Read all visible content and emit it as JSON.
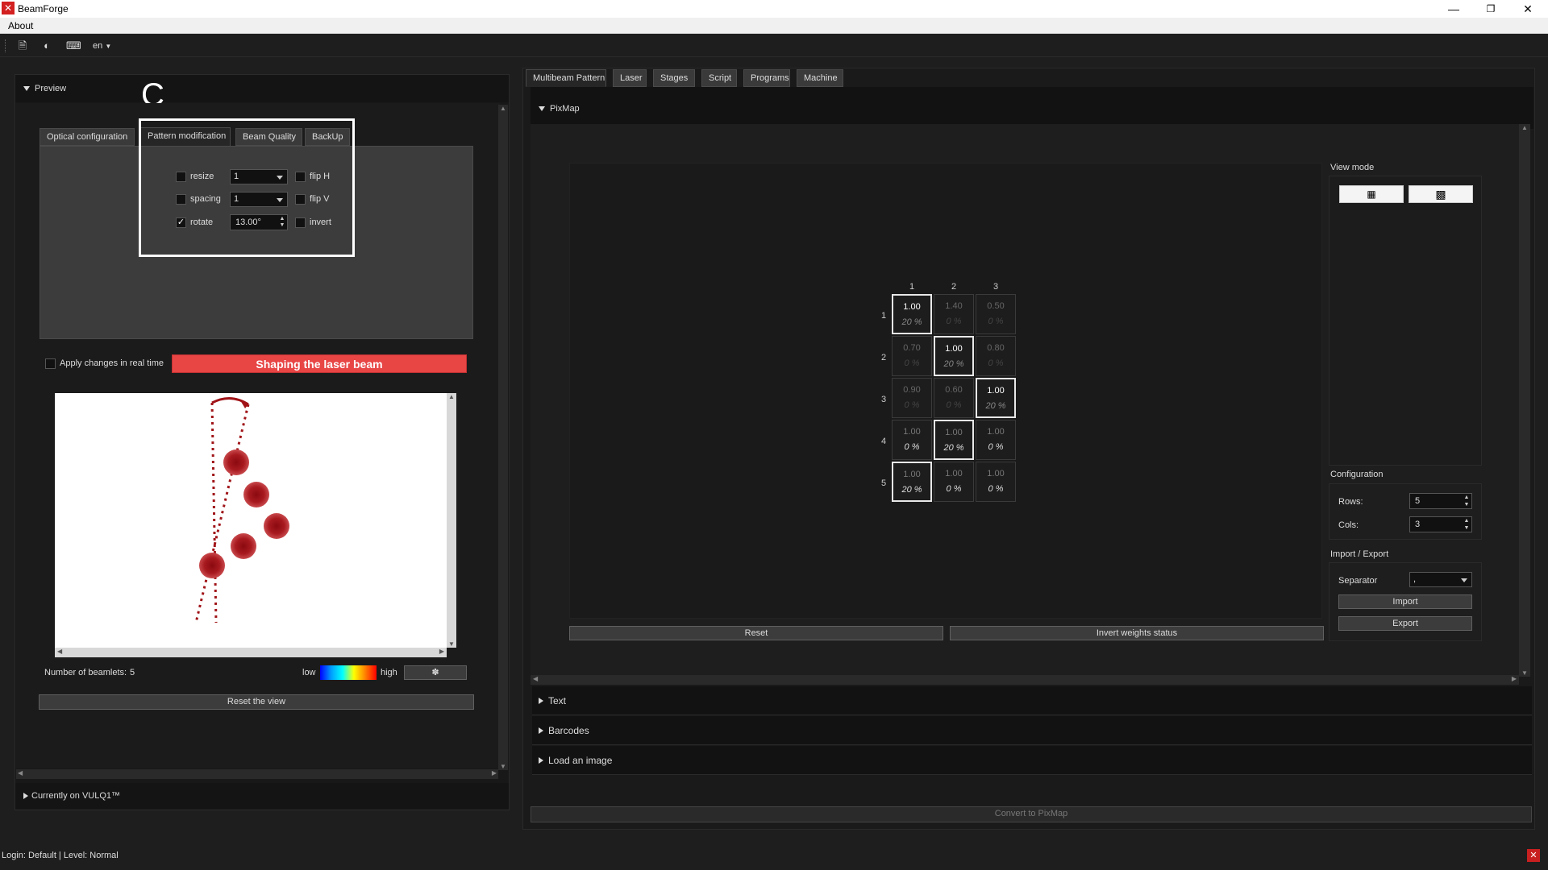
{
  "app": {
    "title": "BeamForge",
    "icon_letter": "✕"
  },
  "menu": {
    "about": "About"
  },
  "toolbar": {
    "language": "en",
    "icons": [
      "document-icon",
      "contrast-icon",
      "keyboard-icon"
    ]
  },
  "preview": {
    "header": "Preview",
    "marker": "C",
    "tabs": [
      "Optical configuration",
      "Pattern modification",
      "Beam Quality",
      "BackUp"
    ],
    "pattern_mod": {
      "resize_label": "resize",
      "resize_value": "1",
      "resize_checked": "",
      "spacing_label": "spacing",
      "spacing_value": "1",
      "spacing_checked": "",
      "rotate_label": "rotate",
      "rotate_value": "13.00°",
      "rotate_checked": "✓",
      "flip_h_label": "flip H",
      "flip_v_label": "flip V",
      "invert_label": "invert"
    },
    "apply_realtime_label": "Apply changes in real time",
    "shaping_button": "Shaping the laser beam",
    "beamlets_label": "Number of beamlets:",
    "beamlets_count": "5",
    "scale_low": "low",
    "scale_high": "high",
    "reset_view": "Reset the view",
    "currently_on": "Currently on VULQ1™"
  },
  "main_tabs": [
    "Multibeam Pattern",
    "Laser",
    "Stages",
    "Script",
    "Programs",
    "Machine"
  ],
  "pixmap": {
    "header": "PixMap",
    "col_headers": [
      "1",
      "2",
      "3"
    ],
    "row_headers": [
      "1",
      "2",
      "3",
      "4",
      "5"
    ],
    "cells": [
      [
        {
          "v": "1.00",
          "p": "20 %"
        },
        {
          "v": "1.40",
          "p": "0 %"
        },
        {
          "v": "0.50",
          "p": "0 %"
        }
      ],
      [
        {
          "v": "0.70",
          "p": "0 %"
        },
        {
          "v": "1.00",
          "p": "20 %"
        },
        {
          "v": "0.80",
          "p": "0 %"
        }
      ],
      [
        {
          "v": "0.90",
          "p": "0 %"
        },
        {
          "v": "0.60",
          "p": "0 %"
        },
        {
          "v": "1.00",
          "p": "20 %"
        }
      ],
      [
        {
          "v": "1.00",
          "p": "0 %"
        },
        {
          "v": "1.00",
          "p": "20 %"
        },
        {
          "v": "1.00",
          "p": "0 %"
        }
      ],
      [
        {
          "v": "1.00",
          "p": "20 %"
        },
        {
          "v": "1.00",
          "p": "0 %"
        },
        {
          "v": "1.00",
          "p": "0 %"
        }
      ]
    ],
    "reset_button": "Reset",
    "invert_button": "Invert weights status",
    "view_mode_label": "View mode",
    "configuration_label": "Configuration",
    "rows_label": "Rows:",
    "rows_value": "5",
    "cols_label": "Cols:",
    "cols_value": "3",
    "import_export_label": "Import / Export",
    "separator_label": "Separator",
    "separator_value": ",",
    "import_button": "Import",
    "export_button": "Export"
  },
  "sections": {
    "text": "Text",
    "barcodes": "Barcodes",
    "load_image": "Load an image"
  },
  "convert_button": "Convert to PixMap",
  "status": {
    "login": "Login: Default | Level: Normal"
  },
  "colors": {
    "accent_red": "#e84545",
    "highlight_border": "#ffffff",
    "beam_red": "#a01418"
  }
}
